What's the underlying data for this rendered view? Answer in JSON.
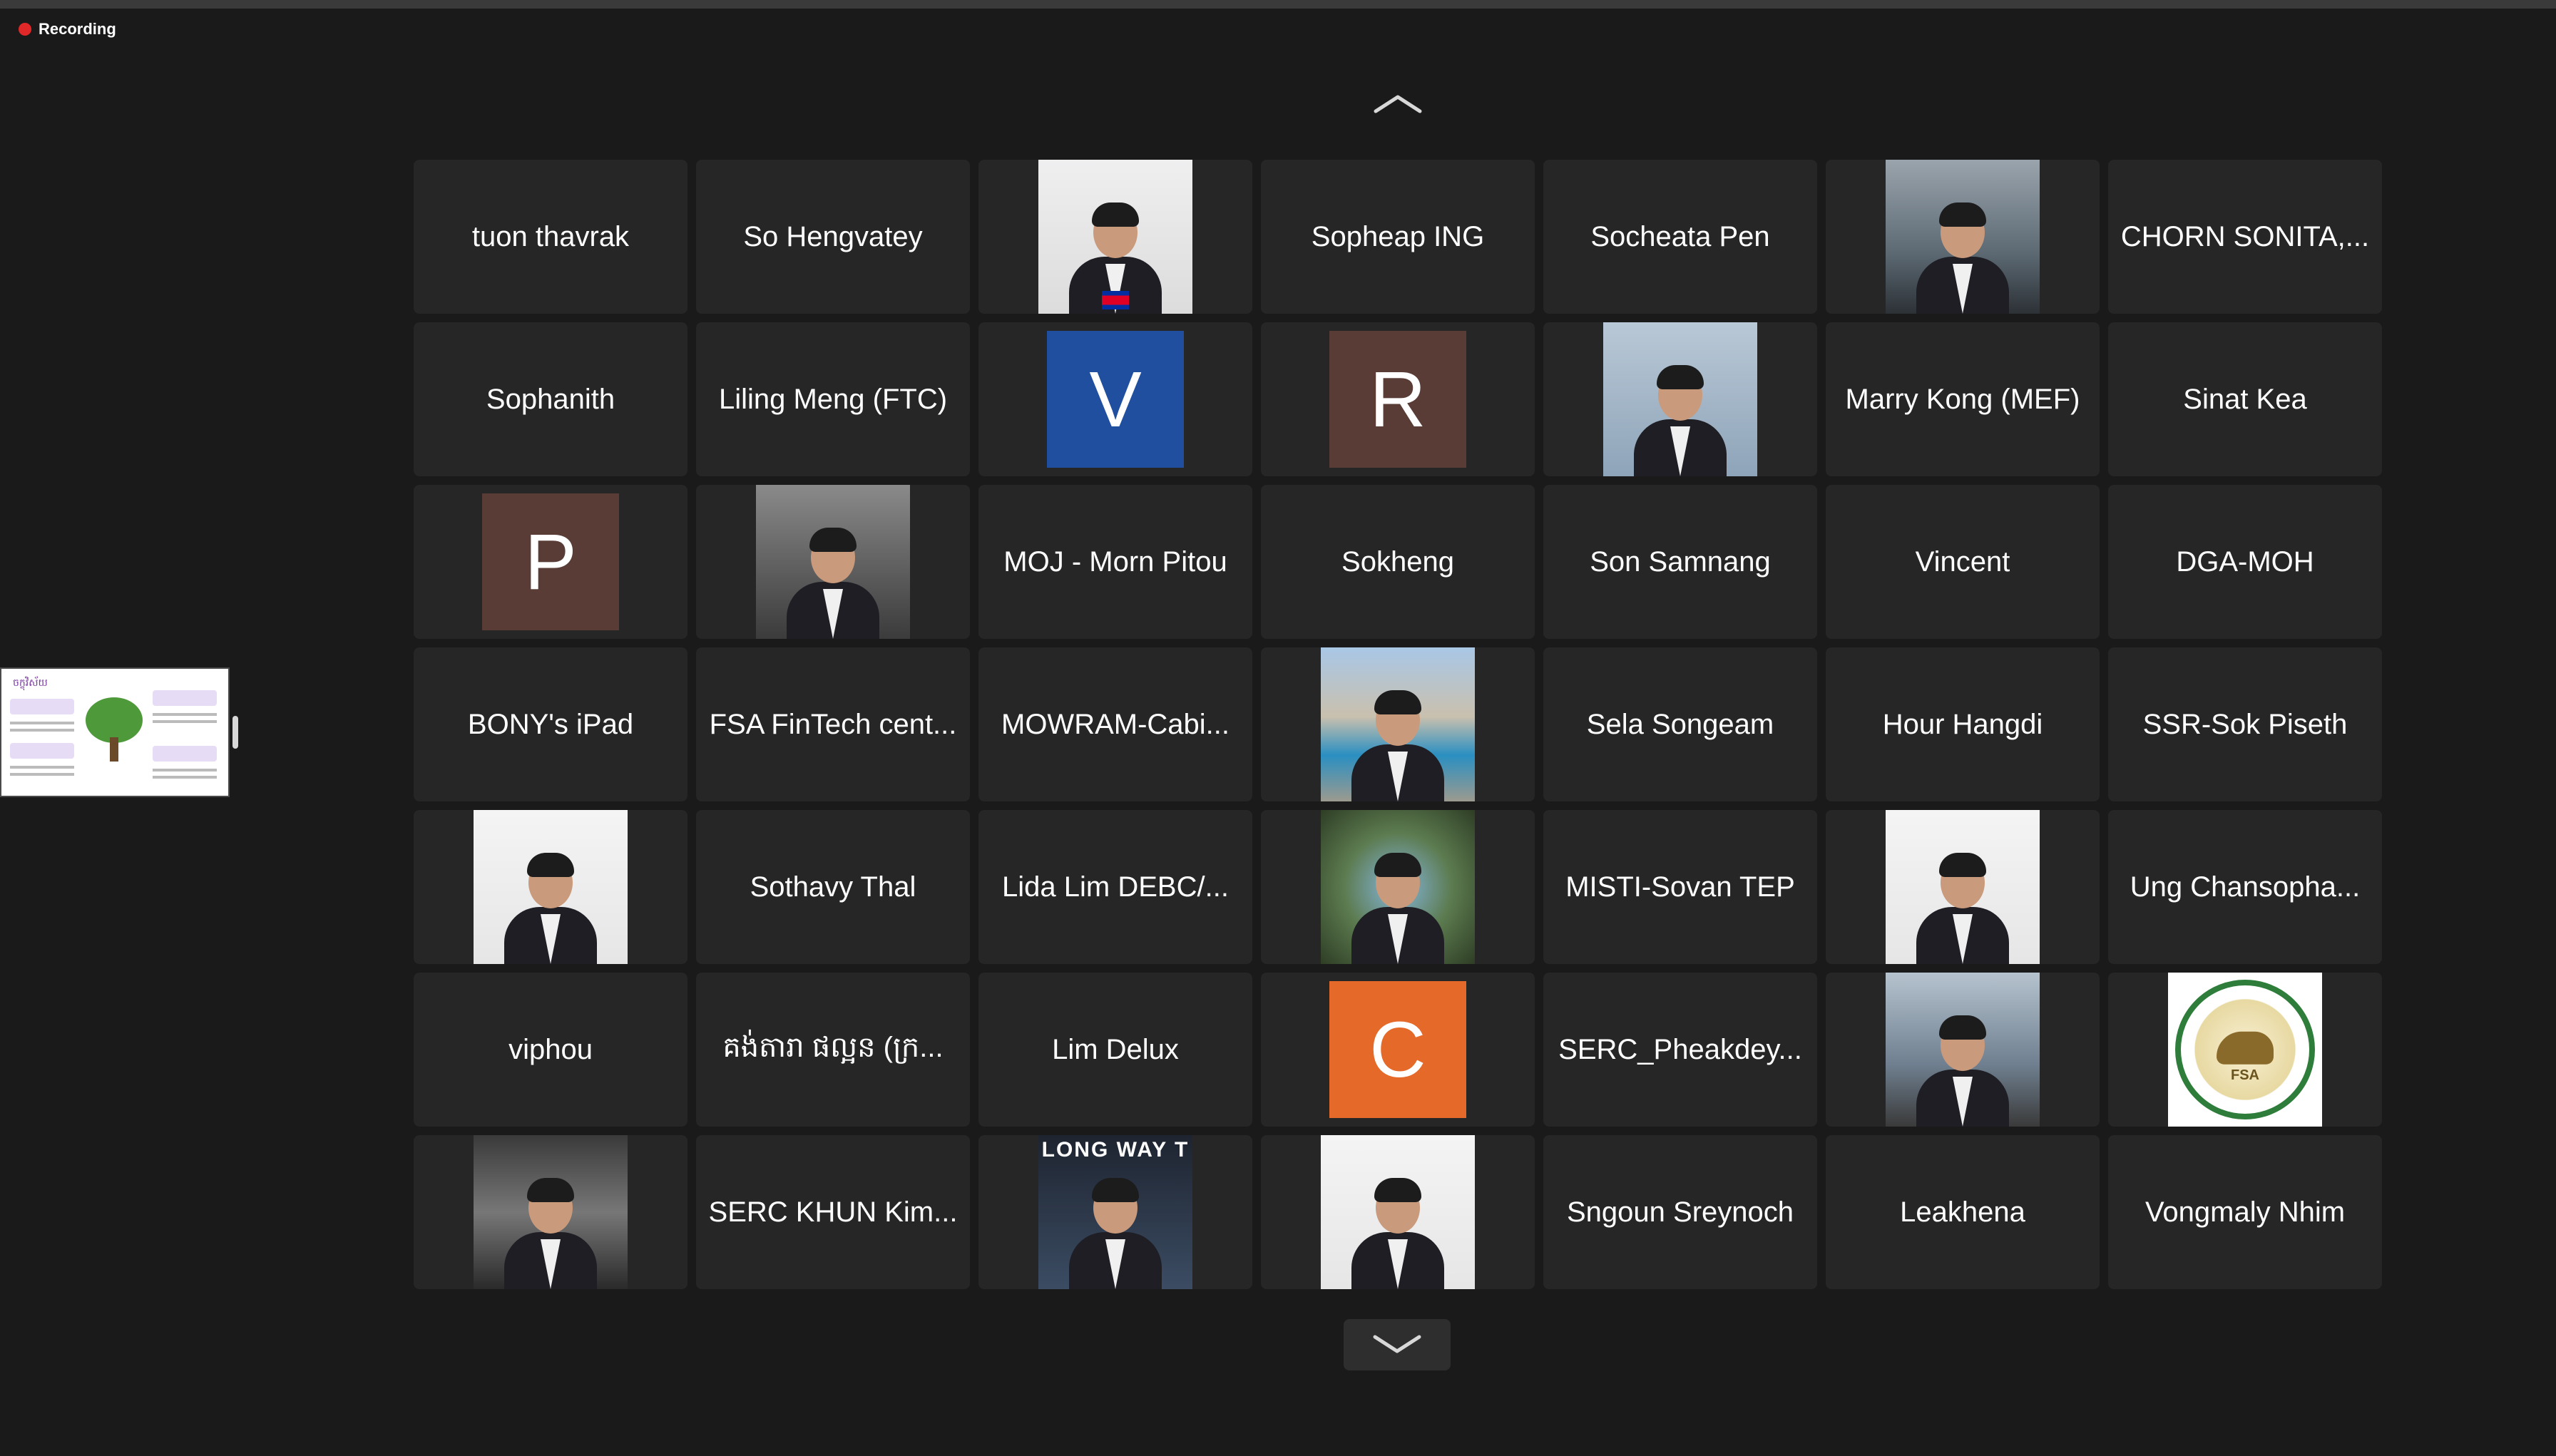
{
  "recording": {
    "label": "Recording",
    "color": "#e02828"
  },
  "navigation": {
    "up_icon": "chevron-up-icon",
    "down_icon": "chevron-down-icon"
  },
  "shared_screen_thumbnail": {
    "title": "ចក្ខុវិស័យ"
  },
  "participants": [
    {
      "type": "name",
      "name": "tuon thavrak"
    },
    {
      "type": "name",
      "name": "So Hengvatey"
    },
    {
      "type": "photo",
      "photo": "ph-light"
    },
    {
      "type": "name",
      "name": "Sopheap ING"
    },
    {
      "type": "name",
      "name": "Socheata Pen"
    },
    {
      "type": "photo",
      "photo": "ph-office"
    },
    {
      "type": "name",
      "name": "CHORN SONITA,..."
    },
    {
      "type": "name",
      "name": "Sophanith"
    },
    {
      "type": "name",
      "name": "Liling Meng (FTC)"
    },
    {
      "type": "letter",
      "letter": "V",
      "color": "#1f4f9e"
    },
    {
      "type": "letter",
      "letter": "R",
      "color": "#5a3c36"
    },
    {
      "type": "photo",
      "photo": "ph-blue"
    },
    {
      "type": "name",
      "name": "Marry Kong (MEF)"
    },
    {
      "type": "name",
      "name": "Sinat Kea"
    },
    {
      "type": "letter",
      "letter": "P",
      "color": "#5a3c36"
    },
    {
      "type": "photo",
      "photo": "ph-event"
    },
    {
      "type": "name",
      "name": "MOJ - Morn Pitou"
    },
    {
      "type": "name",
      "name": "Sokheng"
    },
    {
      "type": "name",
      "name": "Son Samnang"
    },
    {
      "type": "name",
      "name": "Vincent"
    },
    {
      "type": "name",
      "name": "DGA-MOH"
    },
    {
      "type": "name",
      "name": "BONY's iPad"
    },
    {
      "type": "name",
      "name": "FSA FinTech cent..."
    },
    {
      "type": "name",
      "name": "MOWRAM-Cabi..."
    },
    {
      "type": "photo",
      "photo": "ph-pool"
    },
    {
      "type": "name",
      "name": "Sela Songeam"
    },
    {
      "type": "name",
      "name": "Hour Hangdi"
    },
    {
      "type": "name",
      "name": "SSR-Sok Piseth"
    },
    {
      "type": "photo",
      "photo": "ph-white"
    },
    {
      "type": "name",
      "name": "Sothavy Thal"
    },
    {
      "type": "name",
      "name": "Lida Lim DEBC/..."
    },
    {
      "type": "photo",
      "photo": "ph-trees"
    },
    {
      "type": "name",
      "name": "MISTI-Sovan TEP"
    },
    {
      "type": "photo",
      "photo": "ph-white"
    },
    {
      "type": "name",
      "name": "Ung Chansopha..."
    },
    {
      "type": "name",
      "name": "viphou"
    },
    {
      "type": "name",
      "name": "គង់តារា ផល្អន (ក្រ..."
    },
    {
      "type": "name",
      "name": "Lim Delux"
    },
    {
      "type": "letter",
      "letter": "C",
      "color": "#e56a2a"
    },
    {
      "type": "name",
      "name": "SERC_Pheakdey..."
    },
    {
      "type": "photo",
      "photo": "ph-meeting"
    },
    {
      "type": "photo",
      "photo": "ph-seal",
      "seal_text": "FSA"
    },
    {
      "type": "photo",
      "photo": "ph-dark"
    },
    {
      "type": "name",
      "name": "SERC KHUN Kim..."
    },
    {
      "type": "photo",
      "photo": "ph-poster",
      "poster_text": "LONG WAY T"
    },
    {
      "type": "photo",
      "photo": "ph-white"
    },
    {
      "type": "name",
      "name": "Sngoun Sreynoch"
    },
    {
      "type": "name",
      "name": "Leakhena"
    },
    {
      "type": "name",
      "name": "Vongmaly Nhim"
    }
  ]
}
